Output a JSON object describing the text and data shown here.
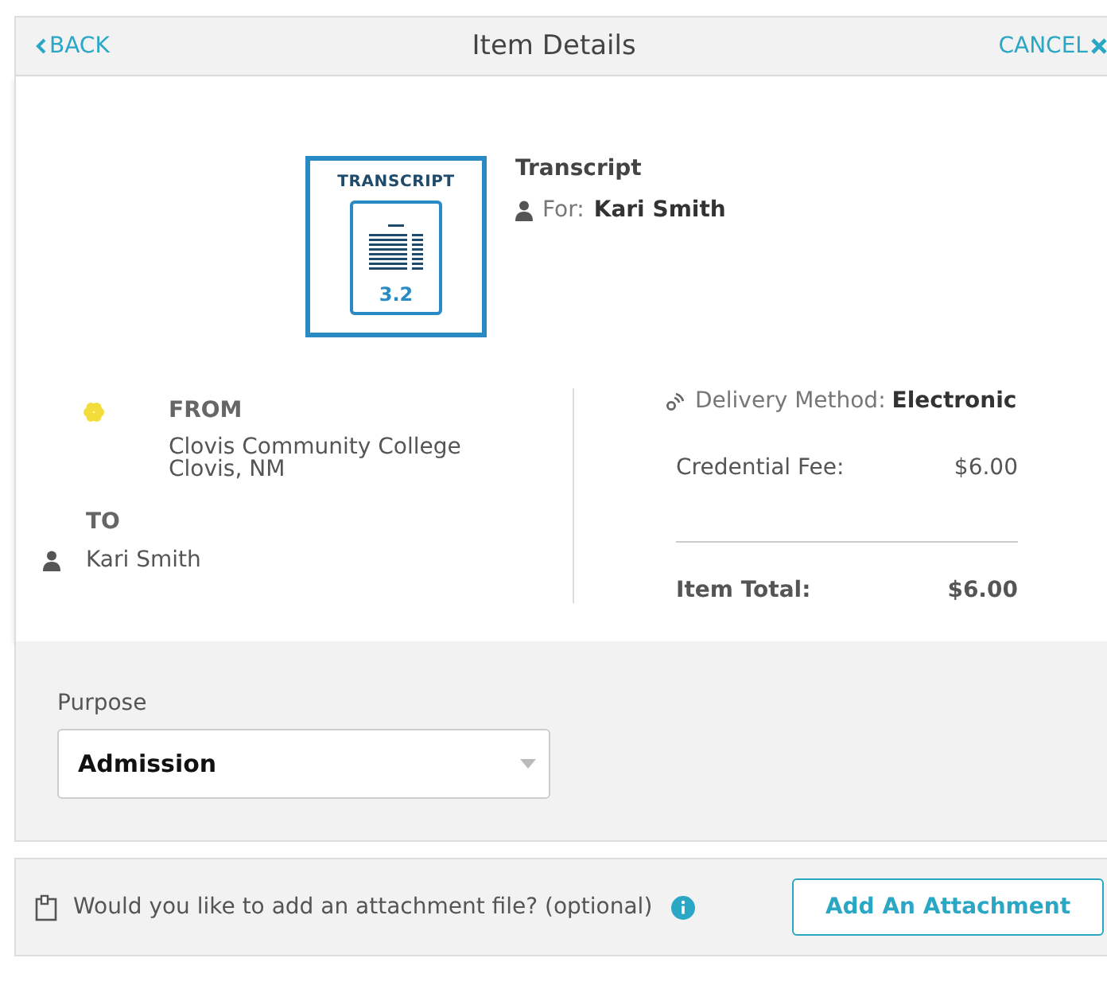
{
  "header": {
    "back": "BACK",
    "title": "Item Details",
    "cancel": "CANCEL"
  },
  "item": {
    "badge_title": "TRANSCRIPT",
    "badge_version": "3.2",
    "name": "Transcript",
    "for_label": "For:",
    "for_name": "Kari Smith"
  },
  "from": {
    "label": "FROM",
    "lines": [
      "Clovis Community College",
      "Clovis, NM"
    ]
  },
  "to": {
    "label": "TO",
    "name": "Kari Smith"
  },
  "delivery": {
    "label": "Delivery Method:",
    "value": "Electronic"
  },
  "fees": [
    {
      "label": "Credential Fee:",
      "amount": "$6.00",
      "kind": "fee"
    },
    {
      "label": "Item Total:",
      "amount": "$6.00",
      "kind": "total"
    }
  ],
  "purpose": {
    "label": "Purpose",
    "value": "Admission"
  },
  "attachment": {
    "question": "Would you like to add an attachment file? (optional)",
    "button": "Add An Attachment"
  }
}
